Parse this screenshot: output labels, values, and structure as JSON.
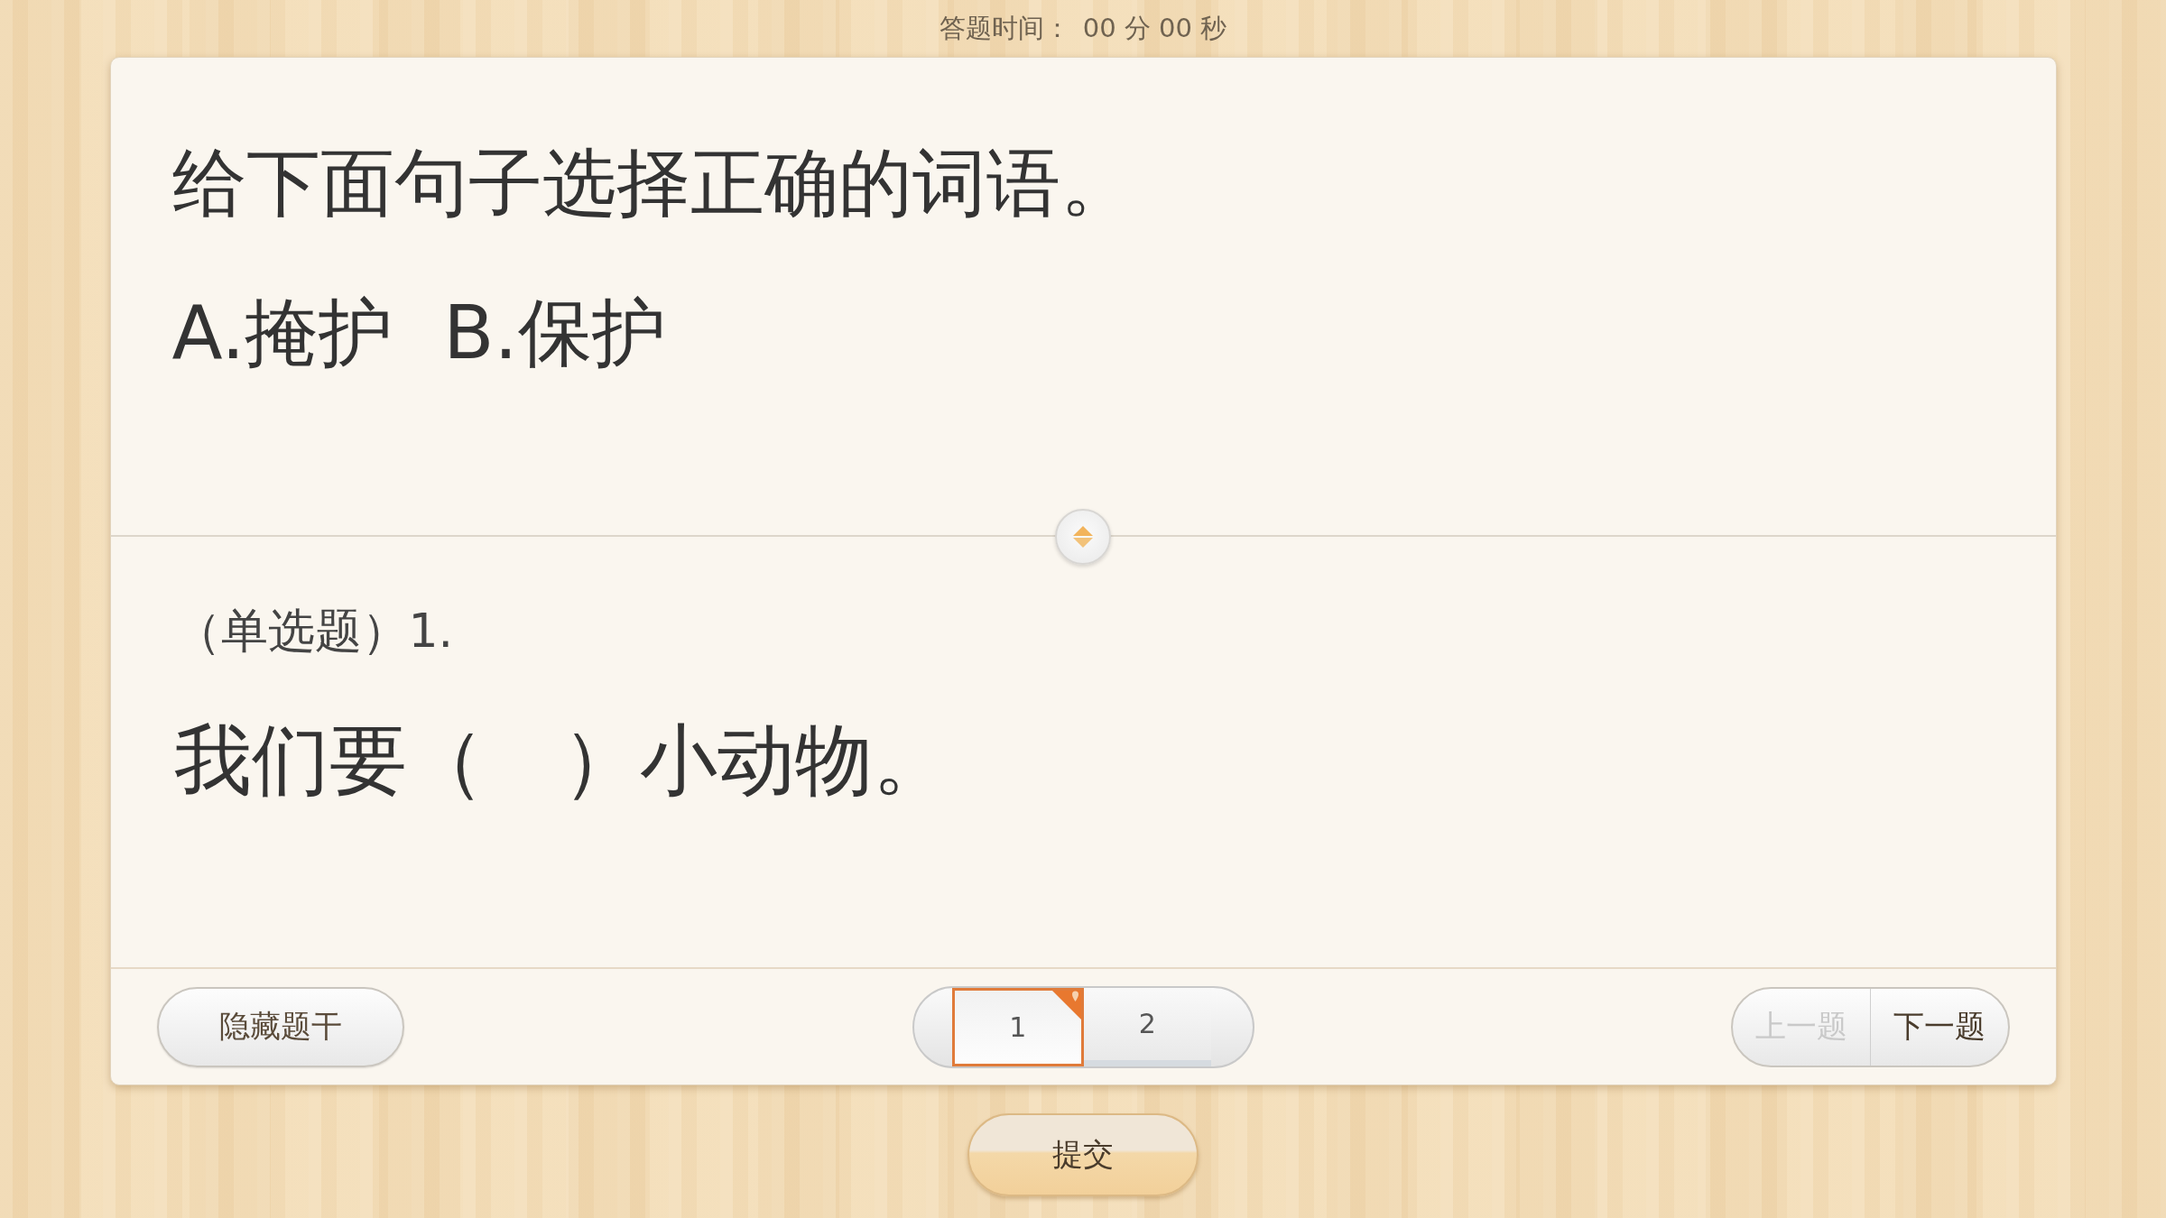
{
  "timer": {
    "label": "答题时间：",
    "value": "00 分 00 秒"
  },
  "stem": {
    "title": "给下面句子选择正确的词语。",
    "options": [
      "A.掩护",
      "B.保护"
    ]
  },
  "question": {
    "type_label": "（单选题）1.",
    "text": "我们要（　）小动物。"
  },
  "hide_stem_button": {
    "label": "隐藏题干"
  },
  "pages": [
    {
      "label": "1",
      "selected": true,
      "marked": true
    },
    {
      "label": "2",
      "selected": false,
      "marked": false
    }
  ],
  "prev_button": {
    "label": "上一题",
    "disabled": true
  },
  "next_button": {
    "label": "下一题",
    "disabled": false
  },
  "submit_button": {
    "label": "提交"
  }
}
